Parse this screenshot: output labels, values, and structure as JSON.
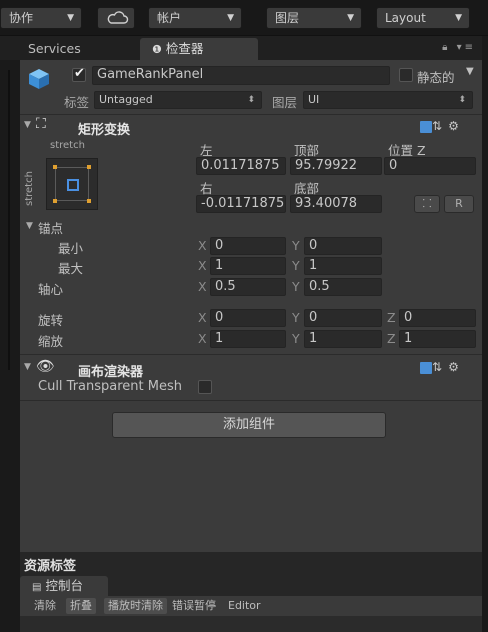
{
  "toolbar": {
    "collab_label": "协作",
    "account_label": "帐户",
    "layers_label": "图层",
    "layout_label": "Layout"
  },
  "tabs": {
    "services": "Services",
    "inspector": "检查器"
  },
  "object": {
    "name": "GameRankPanel",
    "static_label": "静态的",
    "tag_label": "标签",
    "tag_value": "Untagged",
    "layer_label": "图层",
    "layer_value": "UI"
  },
  "rect_transform": {
    "title": "矩形变换",
    "anchor_preset_top": "stretch",
    "anchor_preset_side": "stretch",
    "left_label": "左",
    "left_value": "0.01171875",
    "top_label": "顶部",
    "top_value": "95.79922",
    "posz_label": "位置 Z",
    "posz_value": "0",
    "right_label": "右",
    "right_value": "-0.01171875",
    "bottom_label": "底部",
    "bottom_value": "93.40078",
    "r_button": "R",
    "anchors_label": "锚点",
    "min_label": "最小",
    "min_x": "0",
    "min_y": "0",
    "max_label": "最大",
    "max_x": "1",
    "max_y": "1",
    "pivot_label": "轴心",
    "pivot_x": "0.5",
    "pivot_y": "0.5",
    "rotation_label": "旋转",
    "rot_x": "0",
    "rot_y": "0",
    "rot_z": "0",
    "scale_label": "缩放",
    "scale_x": "1",
    "scale_y": "1",
    "scale_z": "1",
    "axis_x": "X",
    "axis_y": "Y",
    "axis_z": "Z"
  },
  "canvas_renderer": {
    "title": "画布渲染器",
    "cull_label": "Cull Transparent Mesh"
  },
  "add_component_label": "添加组件",
  "bottom": {
    "asset_labels_title": "资源标签",
    "console_tab": "控制台",
    "buttons": [
      "清除",
      "折叠",
      "播放时清除",
      "错误暂停",
      "Editor"
    ]
  }
}
